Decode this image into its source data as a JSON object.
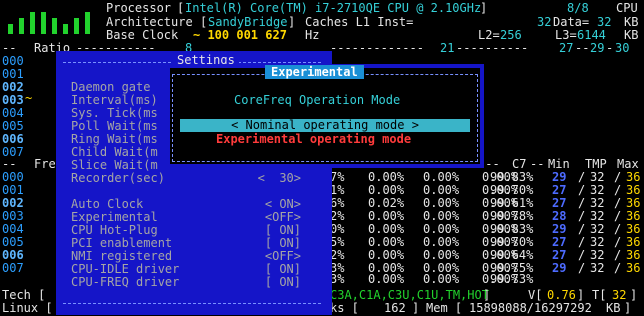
{
  "header": {
    "processor_label": "Processor",
    "processor_value": "Intel(R) Core(TM) i7-2710QE CPU @ 2.10GHz",
    "threads": "8/8",
    "threads_unit": "CPU",
    "arch_label": "Architecture",
    "arch_value": "SandyBridge",
    "caches_label": "Caches L1 Inst=",
    "l1_inst": "32",
    "l1_data_label": "Data=",
    "l1_data": "32",
    "kb": "KB",
    "base_clock_label": "Base Clock",
    "base_clock_value": "~ 100 001 627",
    "hz": "Hz",
    "l2_label": "L2=",
    "l2_value": "256",
    "l3_label": "L3=",
    "l3_value": "6144",
    "ratio_label": "Ratio",
    "ratio_ticks": [
      "8",
      "21",
      "27",
      "29",
      "30"
    ]
  },
  "cpus_top": [
    "000",
    "001",
    "002",
    "003",
    "004",
    "005",
    "006",
    "007"
  ],
  "cpus_bottom": [
    "000",
    "001",
    "002",
    "003",
    "004",
    "005",
    "006",
    "007"
  ],
  "freq_label": "Fre",
  "columns": {
    "c7": "C7",
    "min": "Min",
    "tmp": "TMP",
    "max": "Max"
  },
  "rows": [
    {
      "pct": "7%",
      "a": "0.00%",
      "b": "0.00%",
      "c": "0.00%",
      "c7": "99.83%",
      "min": "29",
      "tmp": "32",
      "max": "36"
    },
    {
      "pct": "1%",
      "a": "0.00%",
      "b": "0.00%",
      "c": "0.00%",
      "c7": "99.70%",
      "min": "27",
      "tmp": "32",
      "max": "36"
    },
    {
      "pct": "6%",
      "a": "0.02%",
      "b": "0.00%",
      "c": "0.00%",
      "c7": "99.61%",
      "min": "27",
      "tmp": "32",
      "max": "36"
    },
    {
      "pct": "2%",
      "a": "0.00%",
      "b": "0.00%",
      "c": "0.00%",
      "c7": "99.78%",
      "min": "28",
      "tmp": "32",
      "max": "36"
    },
    {
      "pct": "0%",
      "a": "0.00%",
      "b": "0.00%",
      "c": "0.00%",
      "c7": "99.83%",
      "min": "29",
      "tmp": "32",
      "max": "36"
    },
    {
      "pct": "5%",
      "a": "0.00%",
      "b": "0.00%",
      "c": "0.00%",
      "c7": "99.70%",
      "min": "27",
      "tmp": "32",
      "max": "36"
    },
    {
      "pct": "2%",
      "a": "0.00%",
      "b": "0.00%",
      "c": "0.00%",
      "c7": "99.64%",
      "min": "27",
      "tmp": "32",
      "max": "36"
    },
    {
      "pct": "3%",
      "a": "0.00%",
      "b": "0.00%",
      "c": "0.00%",
      "c7": "99.75%",
      "min": "29",
      "tmp": "32",
      "max": "36"
    }
  ],
  "summary_row": {
    "pct": "3%",
    "a": "0.00%",
    "b": "0.00%",
    "c": "0.00%",
    "c7": "99.73%"
  },
  "footer": {
    "tech_label": "Tech [",
    "tech_flags": "C3A,C1A,C3U,C1U,TM,HOT",
    "voltage_label": "V[",
    "voltage": "0.76",
    "temp_label": "T[",
    "temp": "32",
    "linux_label": "Linux [",
    "tasks_label": "ks [",
    "tasks": "162",
    "mem_label": "Mem [",
    "mem": "15898088/16297292",
    "mem_unit": "KB"
  },
  "settings": {
    "title": "Settings",
    "items": [
      {
        "label": "Daemon gate",
        "value": ""
      },
      {
        "label": "Interval(ms)",
        "value": ""
      },
      {
        "label": "Sys. Tick(ms",
        "value": ""
      },
      {
        "label": "Poll Wait(ms",
        "value": ""
      },
      {
        "label": "Ring Wait(ms",
        "value": ""
      },
      {
        "label": "Child Wait(m",
        "value": ""
      },
      {
        "label": "Slice Wait(m",
        "value": ""
      },
      {
        "label": "Recorder(sec)",
        "value": "<  30>"
      },
      {
        "label": "",
        "value": ""
      },
      {
        "label": "Auto Clock",
        "value": "< ON>"
      },
      {
        "label": "Experimental",
        "value": "<OFF>"
      },
      {
        "label": "CPU Hot-Plug",
        "value": "[ ON]"
      },
      {
        "label": "PCI enablement",
        "value": "[ ON]"
      },
      {
        "label": "NMI registered",
        "value": "<OFF>"
      },
      {
        "label": "CPU-IDLE driver",
        "value": "[ ON]"
      },
      {
        "label": "CPU-FREQ driver",
        "value": "[ ON]"
      }
    ]
  },
  "experimental": {
    "title": "Experimental",
    "heading": "CoreFreq Operation Mode",
    "option_nominal": "< Nominal operating mode >",
    "option_experimental": "Experimental operating mode"
  }
}
